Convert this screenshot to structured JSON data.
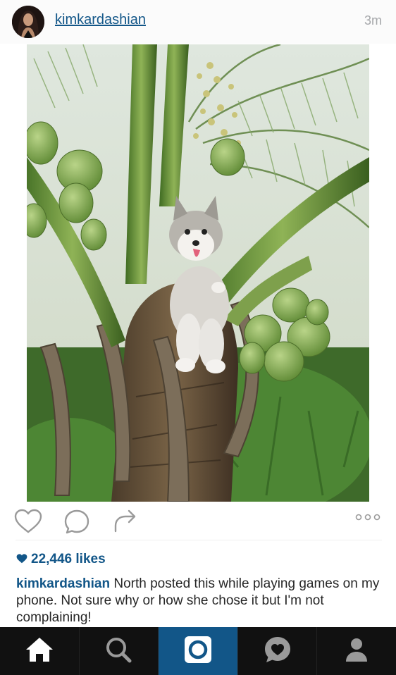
{
  "post": {
    "username": "kimkardashian",
    "time_ago": "3m",
    "likes_count": "22,446 likes",
    "caption_author": "kimkardashian",
    "caption_text": " North posted this while playing games on my phone. Not sure why or how she chose it but I'm not complaining!"
  },
  "actions": {
    "icons": [
      "heart-icon",
      "comment-icon",
      "share-icon",
      "more-options-icon"
    ]
  },
  "tabbar": {
    "items": [
      "home-icon",
      "search-icon",
      "camera-icon",
      "activity-icon",
      "profile-icon"
    ],
    "active": "camera-icon"
  },
  "colors": {
    "link_blue": "#125688",
    "tab_bar": "#111111",
    "active_tab": "#125688",
    "timestamp_gray": "#a5a7aa"
  }
}
